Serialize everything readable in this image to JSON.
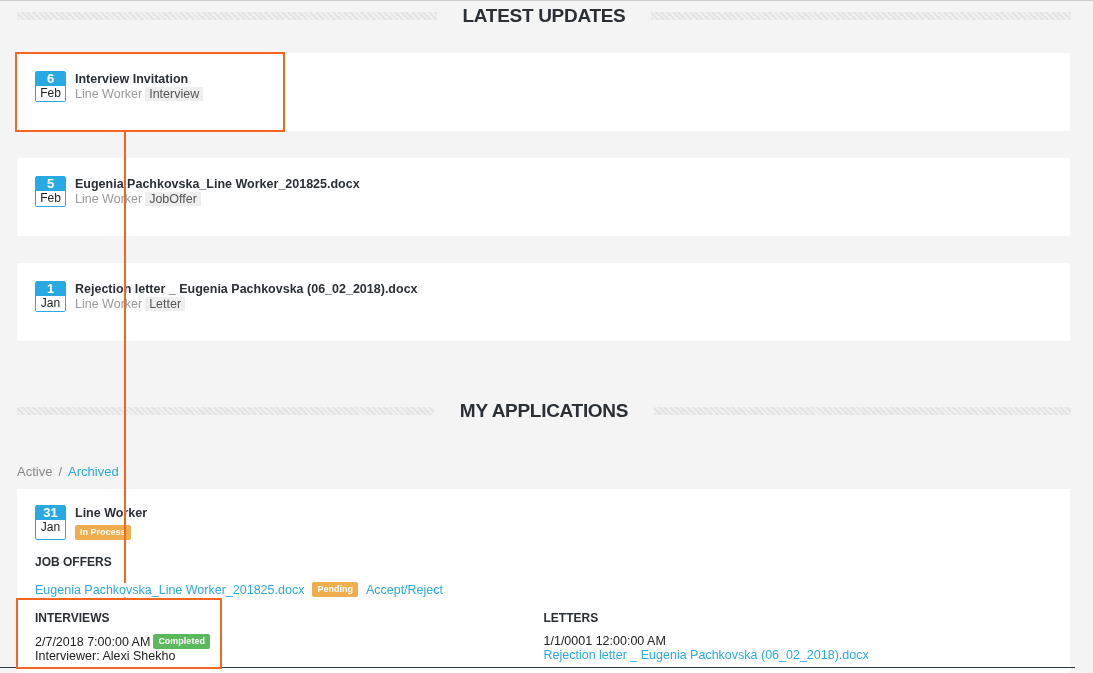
{
  "latest_updates": {
    "title": "LATEST UPDATES",
    "items": [
      {
        "day": "6",
        "month": "Feb",
        "title": "Interview Invitation",
        "job": "Line Worker",
        "tag": "Interview"
      },
      {
        "day": "5",
        "month": "Feb",
        "title": "Eugenia Pachkovska_Line Worker_201825.docx",
        "job": "Line Worker",
        "tag": "JobOffer"
      },
      {
        "day": "1",
        "month": "Jan",
        "title": "Rejection letter _ Eugenia Pachkovska (06_02_2018).docx",
        "job": "Line Worker",
        "tag": "Letter"
      }
    ]
  },
  "my_applications": {
    "title": "MY APPLICATIONS",
    "tabs": [
      {
        "label": "Active",
        "selected": true
      },
      {
        "label": "Archived",
        "selected": false
      }
    ],
    "tab_separator": "/",
    "application": {
      "day": "31",
      "month": "Jan",
      "title": "Line Worker",
      "status": {
        "label": "In Process",
        "color": "#f0ad4e"
      },
      "job_offers": {
        "heading": "JOB OFFERS",
        "file": "Eugenia Pachkovska_Line Worker_201825.docx",
        "status": {
          "label": "Pending",
          "color": "#f0ad4e"
        },
        "action": "Accept/Reject"
      },
      "interviews": {
        "heading": "INTERVIEWS",
        "datetime": "2/7/2018 7:00:00 AM",
        "status": {
          "label": "Completed",
          "color": "#5cb85c"
        },
        "interviewer": "Interviewer: Alexi Shekho"
      },
      "letters": {
        "heading": "LETTERS",
        "datetime": "1/1/0001 12:00:00 AM",
        "file": "Rejection letter _ Eugenia Pachkovska (06_02_2018).docx"
      }
    }
  }
}
